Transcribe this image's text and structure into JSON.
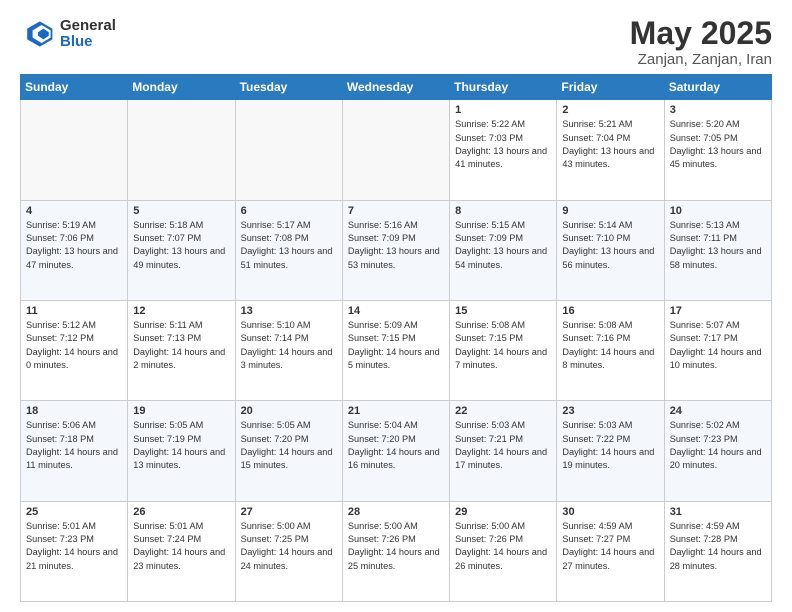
{
  "header": {
    "logo_general": "General",
    "logo_blue": "Blue",
    "title": "May 2025",
    "location": "Zanjan, Zanjan, Iran"
  },
  "calendar": {
    "days_of_week": [
      "Sunday",
      "Monday",
      "Tuesday",
      "Wednesday",
      "Thursday",
      "Friday",
      "Saturday"
    ],
    "weeks": [
      [
        {
          "day": "",
          "empty": true
        },
        {
          "day": "",
          "empty": true
        },
        {
          "day": "",
          "empty": true
        },
        {
          "day": "",
          "empty": true
        },
        {
          "day": "1",
          "sunrise": "5:22 AM",
          "sunset": "7:03 PM",
          "daylight": "13 hours and 41 minutes."
        },
        {
          "day": "2",
          "sunrise": "5:21 AM",
          "sunset": "7:04 PM",
          "daylight": "13 hours and 43 minutes."
        },
        {
          "day": "3",
          "sunrise": "5:20 AM",
          "sunset": "7:05 PM",
          "daylight": "13 hours and 45 minutes."
        }
      ],
      [
        {
          "day": "4",
          "sunrise": "5:19 AM",
          "sunset": "7:06 PM",
          "daylight": "13 hours and 47 minutes."
        },
        {
          "day": "5",
          "sunrise": "5:18 AM",
          "sunset": "7:07 PM",
          "daylight": "13 hours and 49 minutes."
        },
        {
          "day": "6",
          "sunrise": "5:17 AM",
          "sunset": "7:08 PM",
          "daylight": "13 hours and 51 minutes."
        },
        {
          "day": "7",
          "sunrise": "5:16 AM",
          "sunset": "7:09 PM",
          "daylight": "13 hours and 53 minutes."
        },
        {
          "day": "8",
          "sunrise": "5:15 AM",
          "sunset": "7:09 PM",
          "daylight": "13 hours and 54 minutes."
        },
        {
          "day": "9",
          "sunrise": "5:14 AM",
          "sunset": "7:10 PM",
          "daylight": "13 hours and 56 minutes."
        },
        {
          "day": "10",
          "sunrise": "5:13 AM",
          "sunset": "7:11 PM",
          "daylight": "13 hours and 58 minutes."
        }
      ],
      [
        {
          "day": "11",
          "sunrise": "5:12 AM",
          "sunset": "7:12 PM",
          "daylight": "14 hours and 0 minutes."
        },
        {
          "day": "12",
          "sunrise": "5:11 AM",
          "sunset": "7:13 PM",
          "daylight": "14 hours and 2 minutes."
        },
        {
          "day": "13",
          "sunrise": "5:10 AM",
          "sunset": "7:14 PM",
          "daylight": "14 hours and 3 minutes."
        },
        {
          "day": "14",
          "sunrise": "5:09 AM",
          "sunset": "7:15 PM",
          "daylight": "14 hours and 5 minutes."
        },
        {
          "day": "15",
          "sunrise": "5:08 AM",
          "sunset": "7:15 PM",
          "daylight": "14 hours and 7 minutes."
        },
        {
          "day": "16",
          "sunrise": "5:08 AM",
          "sunset": "7:16 PM",
          "daylight": "14 hours and 8 minutes."
        },
        {
          "day": "17",
          "sunrise": "5:07 AM",
          "sunset": "7:17 PM",
          "daylight": "14 hours and 10 minutes."
        }
      ],
      [
        {
          "day": "18",
          "sunrise": "5:06 AM",
          "sunset": "7:18 PM",
          "daylight": "14 hours and 11 minutes."
        },
        {
          "day": "19",
          "sunrise": "5:05 AM",
          "sunset": "7:19 PM",
          "daylight": "14 hours and 13 minutes."
        },
        {
          "day": "20",
          "sunrise": "5:05 AM",
          "sunset": "7:20 PM",
          "daylight": "14 hours and 15 minutes."
        },
        {
          "day": "21",
          "sunrise": "5:04 AM",
          "sunset": "7:20 PM",
          "daylight": "14 hours and 16 minutes."
        },
        {
          "day": "22",
          "sunrise": "5:03 AM",
          "sunset": "7:21 PM",
          "daylight": "14 hours and 17 minutes."
        },
        {
          "day": "23",
          "sunrise": "5:03 AM",
          "sunset": "7:22 PM",
          "daylight": "14 hours and 19 minutes."
        },
        {
          "day": "24",
          "sunrise": "5:02 AM",
          "sunset": "7:23 PM",
          "daylight": "14 hours and 20 minutes."
        }
      ],
      [
        {
          "day": "25",
          "sunrise": "5:01 AM",
          "sunset": "7:23 PM",
          "daylight": "14 hours and 21 minutes."
        },
        {
          "day": "26",
          "sunrise": "5:01 AM",
          "sunset": "7:24 PM",
          "daylight": "14 hours and 23 minutes."
        },
        {
          "day": "27",
          "sunrise": "5:00 AM",
          "sunset": "7:25 PM",
          "daylight": "14 hours and 24 minutes."
        },
        {
          "day": "28",
          "sunrise": "5:00 AM",
          "sunset": "7:26 PM",
          "daylight": "14 hours and 25 minutes."
        },
        {
          "day": "29",
          "sunrise": "5:00 AM",
          "sunset": "7:26 PM",
          "daylight": "14 hours and 26 minutes."
        },
        {
          "day": "30",
          "sunrise": "4:59 AM",
          "sunset": "7:27 PM",
          "daylight": "14 hours and 27 minutes."
        },
        {
          "day": "31",
          "sunrise": "4:59 AM",
          "sunset": "7:28 PM",
          "daylight": "14 hours and 28 minutes."
        }
      ]
    ]
  }
}
